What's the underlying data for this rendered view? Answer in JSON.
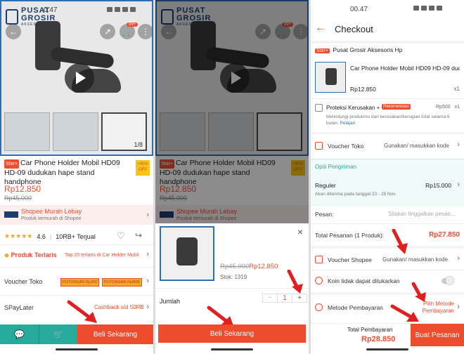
{
  "status": {
    "time_1": "0.47",
    "time_3": "00.47"
  },
  "brand": {
    "line1": "PUSAT",
    "line2": "GROSIR",
    "line3": "AKSESORIS HP"
  },
  "product": {
    "star_label": "Star+",
    "title": "Car Phone Holder Mobil HD09 HD-09 dudukan hape stand handphone",
    "price": "Rp12.850",
    "old_price": "Rp45.000",
    "off_badge": "+40% OFF",
    "image_counter": "1/8",
    "cart_badge": "99+",
    "cart_badge_2": "99+"
  },
  "store_strip": {
    "name": "Shopee Murah Lebay",
    "subtitle": "Produk termurah di Shopee"
  },
  "rating": {
    "stars": "★★★★★",
    "score": "4.6",
    "sold": "10RB+ Terjual"
  },
  "best_product": {
    "label": "Produk Terlaris",
    "detail": "Top 20 terlaris di Car Holder Mobil"
  },
  "voucher_store": {
    "label": "Voucher Toko",
    "tag1": "POTONGAN Rp300",
    "tag2": "POTONGAN Rp9RB"
  },
  "spaylater": {
    "label": "SPayLater",
    "detail": "Cashback s/d 50RB"
  },
  "bottom_bar": {
    "buy_label": "Beli Sekarang"
  },
  "sheet": {
    "strike_price": "Rp45.000",
    "price": "Rp12.850",
    "stock": "Stok: 1319",
    "qty_label": "Jumlah",
    "qty_value": "1",
    "minus": "−",
    "plus": "+",
    "close": "×",
    "buy_label": "Beli Sekarang"
  },
  "checkout": {
    "title": "Checkout",
    "store_star": "Star+",
    "store_name": "Pusat Grosir Aksesoris Hp",
    "item_name": "Car Phone Holder Mobil HD09 HD-09 dud...",
    "item_price": "Rp12.850",
    "item_qty": "x1",
    "protection_label": "Proteksi Kerusakan +",
    "protection_badge": "Rekomendasi",
    "protection_price": "Rp500",
    "protection_qty": "x1",
    "protection_desc": "Melindungi produkmu dari kerusakan/kerugian total selama 6 bulan.",
    "protection_link": "Pelajari",
    "voucher_toko_label": "Voucher Toko",
    "voucher_toko_value": "Gunakan/ masukkan kode",
    "shipping_header": "Opsi Pengiriman",
    "shipping_name": "Reguler",
    "shipping_price": "Rp15.000",
    "shipping_eta": "Akan diterima pada tanggal 23 - 25 Nov",
    "message_label": "Pesan:",
    "message_placeholder": "Silakan tinggalkan pesan...",
    "total_label": "Total Pesanan (1 Produk):",
    "total_value": "Rp27.850",
    "voucher_shopee_label": "Voucher Shopee",
    "voucher_shopee_value": "Gunakan/ masukkan kode",
    "coin_label": "Koin tidak dapat ditukarkan",
    "payment_label": "Metode Pembayaran",
    "payment_value": "Pilih Metode Pembayaran",
    "pay_total_label": "Total Pembayaran",
    "pay_total_value": "Rp28.850",
    "order_button": "Buat Pesanan"
  },
  "colors": {
    "accent": "#ee4d2d",
    "teal": "#26aa99",
    "frame": "#2e6fb3"
  }
}
